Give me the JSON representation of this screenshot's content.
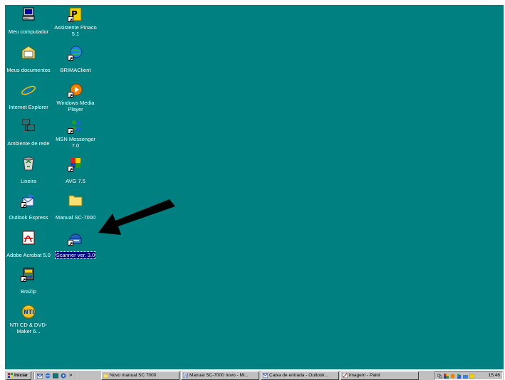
{
  "desktop": {
    "background": "#008080",
    "icons": [
      {
        "label": "Meu computador",
        "icon": "my-computer-icon"
      },
      {
        "label": "Assistente Pinaco 5.1",
        "icon": "assistant-pinaco-icon"
      },
      {
        "label": "Meus documentos",
        "icon": "my-documents-icon"
      },
      {
        "label": "BRIMAClient",
        "icon": "brimaclient-icon"
      },
      {
        "label": "Internet Explorer",
        "icon": "internet-explorer-icon"
      },
      {
        "label": "Windows Media Player",
        "icon": "windows-media-player-icon"
      },
      {
        "label": "Ambiente de rede",
        "icon": "network-places-icon"
      },
      {
        "label": "MSN Messenger 7.0",
        "icon": "msn-messenger-icon"
      },
      {
        "label": "Lixeira",
        "icon": "recycle-bin-icon"
      },
      {
        "label": "AVG 7.5",
        "icon": "avg-icon"
      },
      {
        "label": "Outlook Express",
        "icon": "outlook-express-icon"
      },
      {
        "label": "Manual SC-7000",
        "icon": "folder-icon"
      },
      {
        "label": "Adobe Acrobat 5.0",
        "icon": "adobe-acrobat-icon"
      },
      {
        "label": "Scanner ver. 3.0",
        "icon": "scanner-icon",
        "selected": true
      },
      {
        "label": "BraZip",
        "icon": "brazip-icon"
      },
      {
        "label": "NTI CD & DVD-Maker 6...",
        "icon": "nti-cd-dvd-maker-icon"
      }
    ]
  },
  "taskbar": {
    "start_label": "Iniciar",
    "quicklaunch_more": "»",
    "buttons": [
      {
        "label": "Novo manual SC 7000",
        "icon": "folder-icon"
      },
      {
        "label": "Manual SC-7000 novo - Mi...",
        "icon": "word-document-icon"
      },
      {
        "label": "Caixa de entrada - Outlook...",
        "icon": "outlook-express-icon"
      },
      {
        "label": "imagem - Paint",
        "icon": "paint-icon"
      }
    ],
    "clock": "15:46"
  }
}
